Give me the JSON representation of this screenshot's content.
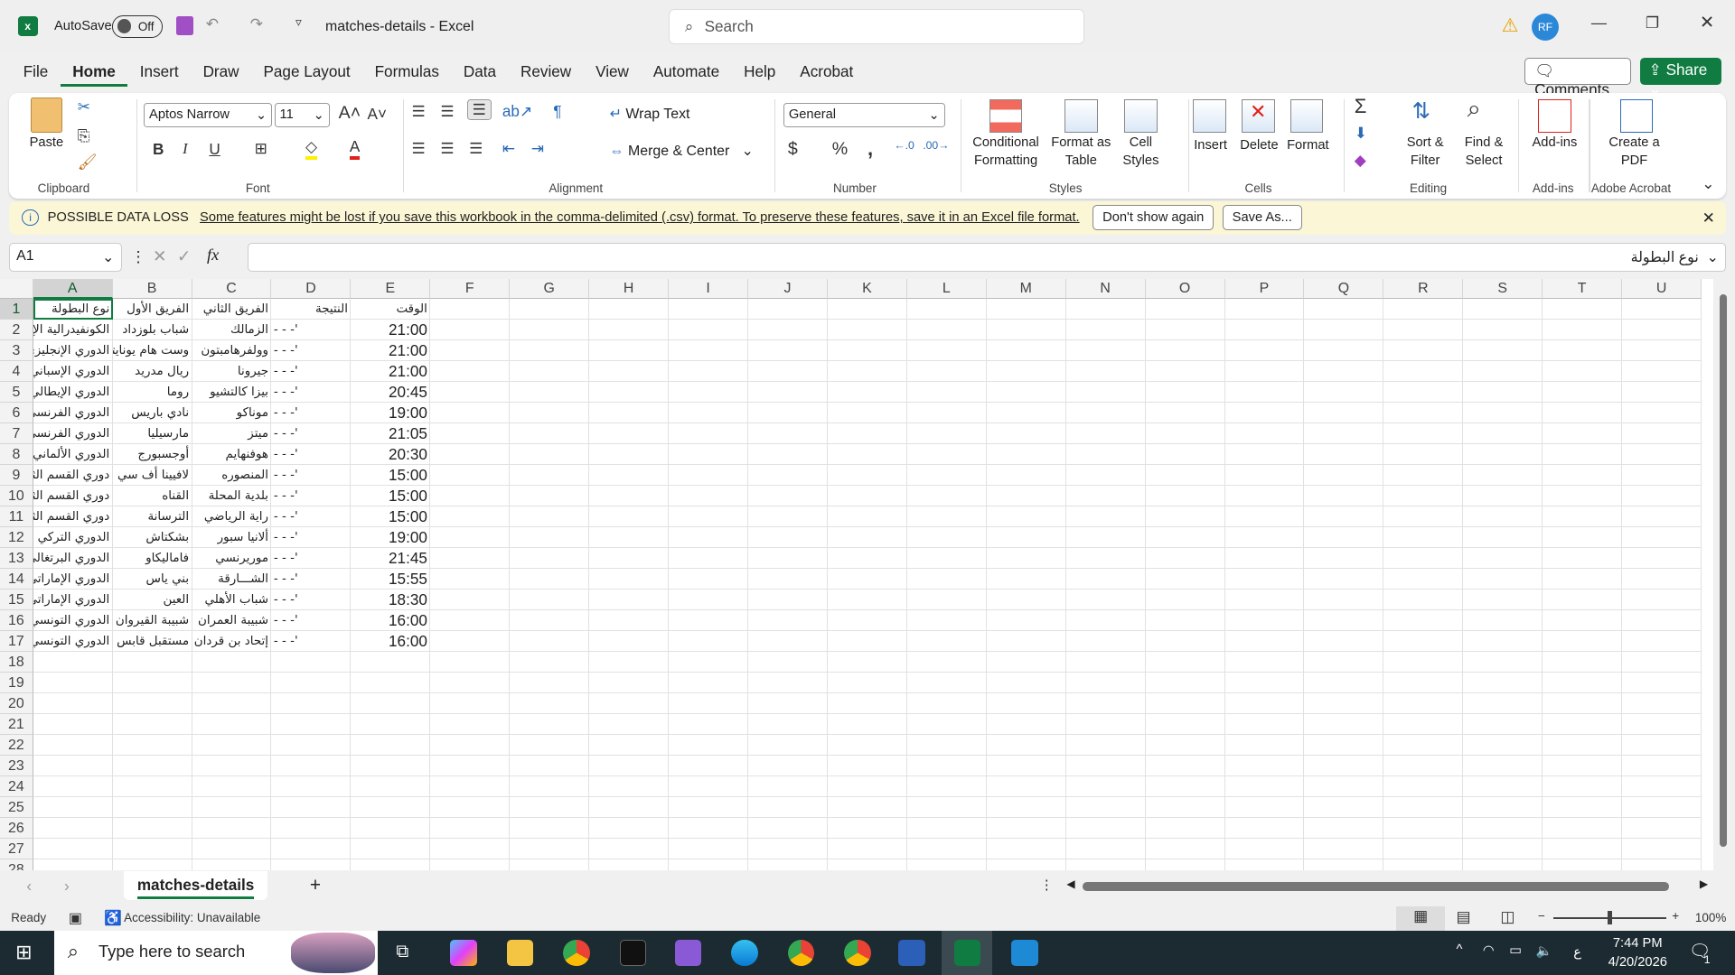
{
  "titlebar": {
    "autosave_label": "AutoSave",
    "autosave_state": "Off",
    "doc_title": "matches-details  -  Excel",
    "search_placeholder": "Search",
    "user_initials": "RF"
  },
  "menu": [
    "File",
    "Home",
    "Insert",
    "Draw",
    "Page Layout",
    "Formulas",
    "Data",
    "Review",
    "View",
    "Automate",
    "Help",
    "Acrobat"
  ],
  "menu_active": "Home",
  "topright": {
    "comments": "Comments",
    "share": "Share"
  },
  "ribbon": {
    "clipboard": {
      "label": "Clipboard",
      "paste": "Paste"
    },
    "font": {
      "label": "Font",
      "font_name": "Aptos Narrow",
      "font_size": "11"
    },
    "alignment": {
      "label": "Alignment",
      "wrap_text": "Wrap Text",
      "merge_center": "Merge & Center"
    },
    "number": {
      "label": "Number",
      "format": "General"
    },
    "styles": {
      "label": "Styles",
      "conditional": "Conditional Formatting",
      "format_table": "Format as Table",
      "cell_styles": "Cell Styles"
    },
    "cells": {
      "label": "Cells",
      "insert": "Insert",
      "delete": "Delete",
      "format": "Format"
    },
    "editing": {
      "label": "Editing",
      "sort_filter": "Sort & Filter",
      "find_select": "Find & Select"
    },
    "addins": {
      "label": "Add-ins",
      "addins": "Add-ins"
    },
    "acrobat": {
      "label": "Adobe Acrobat",
      "create_pdf": "Create a PDF"
    }
  },
  "infobar": {
    "title": "POSSIBLE DATA LOSS",
    "message": "Some features might be lost if you save this workbook in the comma-delimited (.csv) format. To preserve these features, save it in an Excel file format.",
    "dont_show": "Don't show again",
    "save_as": "Save As..."
  },
  "formula_bar": {
    "name_box": "A1",
    "fx": "fx",
    "content": "نوع البطولة"
  },
  "columns": [
    "A",
    "B",
    "C",
    "D",
    "E",
    "F",
    "G",
    "H",
    "I",
    "J",
    "K",
    "L",
    "M",
    "N",
    "O",
    "P",
    "Q",
    "R",
    "S",
    "T",
    "U"
  ],
  "headers": [
    "نوع البطولة",
    "الفريق الأول",
    "الفريق الثاني",
    "النتيجة",
    "الوقت"
  ],
  "rows": [
    [
      "الكونفيدرالية الإفريقية",
      "شباب بلوزداد",
      "الزمالك",
      "- - -'",
      "21:00"
    ],
    [
      "الدوري الإنجليزي",
      "وست هام يونايتد",
      "وولفرهامبتون",
      "- - -'",
      "21:00"
    ],
    [
      "الدوري الإسباني",
      "ريال مدريد",
      "جيرونا",
      "- - -'",
      "21:00"
    ],
    [
      "الدوري الإيطالي",
      "روما",
      "بيزا كالتشيو",
      "- - -'",
      "20:45"
    ],
    [
      "الدوري الفرنسي",
      "نادي باريس",
      "موناكو",
      "- - -'",
      "19:00"
    ],
    [
      "الدوري الفرنسي",
      "مارسيليا",
      "ميتز",
      "- - -'",
      "21:05"
    ],
    [
      "الدوري الألماني",
      "أوجسبورج",
      "هوفنهايم",
      "- - -'",
      "20:30"
    ],
    [
      "دوري القسم الثاني",
      "لافيينا أف سي",
      "المنصوره",
      "- - -'",
      "15:00"
    ],
    [
      "دوري القسم الثاني",
      "القناه",
      "بلدية المحلة",
      "- - -'",
      "15:00"
    ],
    [
      "دوري القسم الثاني",
      "الترسانة",
      "راية الرياضي",
      "- - -'",
      "15:00"
    ],
    [
      "الدوري التركي",
      "بشكتاش",
      "ألانيا سبور",
      "- - -'",
      "19:00"
    ],
    [
      "الدوري البرتغالي",
      "فاماليكاو",
      "موريرنسي",
      "- - -'",
      "21:45"
    ],
    [
      "الدوري الإماراتي",
      "بني ياس",
      "الشـــارقة",
      "- - -'",
      "15:55"
    ],
    [
      "الدوري الإماراتي",
      "العين",
      "شباب الأهلي",
      "- - -'",
      "18:30"
    ],
    [
      "الدوري التونسي",
      "شبيبة القيروان",
      "شبيبة العمران",
      "- - -'",
      "16:00"
    ],
    [
      "الدوري التونسي",
      "مستقبل قابس",
      "إتحاد بن قردان",
      "- - -'",
      "16:00"
    ]
  ],
  "row_count": 28,
  "sheet_tabs": [
    "matches-details"
  ],
  "status": {
    "ready": "Ready",
    "accessibility": "Accessibility: Unavailable",
    "zoom": "100%"
  },
  "taskbar": {
    "search_placeholder": "Type here to search",
    "time": "7:44 PM",
    "date": "4/20/2026",
    "lang": "ع",
    "notifications": "1"
  },
  "colors": {
    "excel_green": "#107c41",
    "infobar_bg": "#fbf6d5",
    "taskbar_bg": "#1c2b31",
    "avatar": "#2b88d8"
  }
}
